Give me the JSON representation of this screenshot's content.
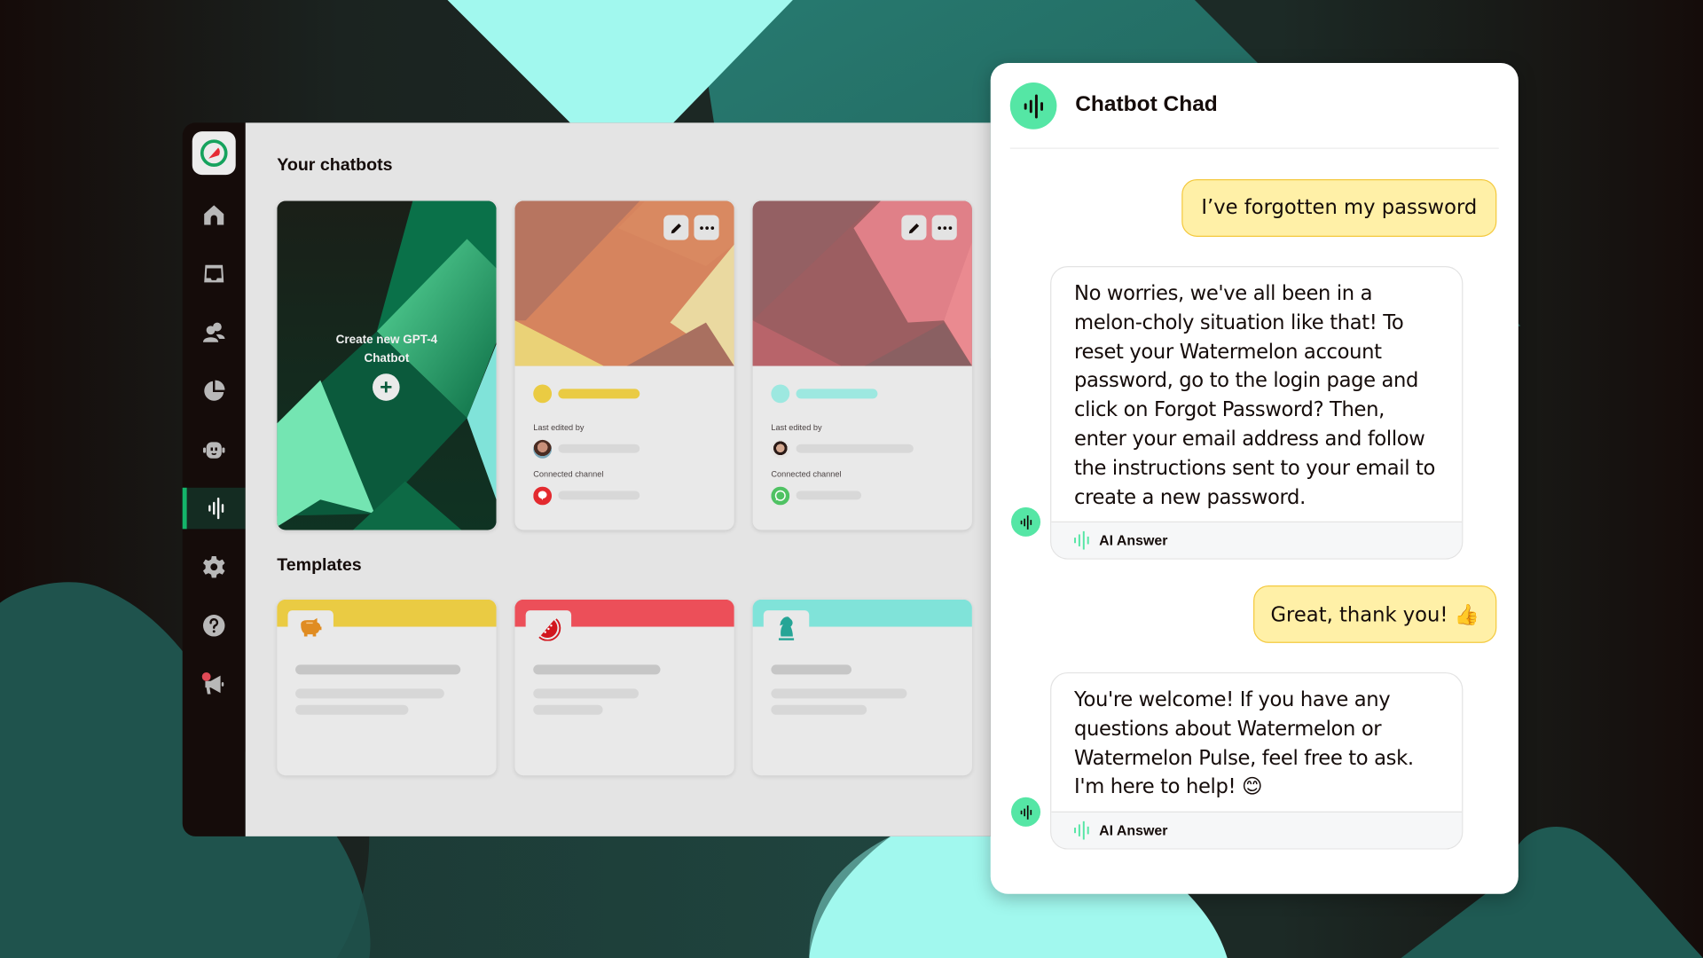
{
  "app": {
    "colors": {
      "accent_green": "#14b46a",
      "bot_avatar": "#55e6a5",
      "user_bubble": "#fff0a7",
      "user_bubble_border": "#f4c93e",
      "sidebar_bg": "#150c0a",
      "panel_bg": "#e4e4e4"
    }
  },
  "sidebar": {
    "logo": "watermelon-logo",
    "items": [
      {
        "name": "home",
        "icon": "home-icon",
        "active": false
      },
      {
        "name": "inbox",
        "icon": "inbox-icon",
        "active": false
      },
      {
        "name": "contacts",
        "icon": "users-icon",
        "active": false
      },
      {
        "name": "reports",
        "icon": "pie-chart-icon",
        "active": false
      },
      {
        "name": "bots",
        "icon": "robot-icon",
        "active": false
      },
      {
        "name": "chatbots",
        "icon": "soundwave-icon",
        "active": true
      },
      {
        "name": "settings",
        "icon": "gear-icon",
        "active": false
      },
      {
        "name": "help",
        "icon": "help-icon",
        "active": false
      },
      {
        "name": "announcements",
        "icon": "megaphone-icon",
        "active": false,
        "notification": true
      }
    ]
  },
  "main": {
    "chatbots_title": "Your chatbots",
    "create_card": {
      "label": "Create new GPT-4 Chatbot",
      "icon": "plus-icon"
    },
    "chatbots": [
      {
        "theme": "orange",
        "accent": "#eacb43",
        "last_edited_label": "Last edited by",
        "connected_channel_label": "Connected channel",
        "channel_icon": "livechat-icon",
        "channel_color": "#e32a2f",
        "edit_icon": "pencil-icon",
        "more_icon": "more-icon"
      },
      {
        "theme": "pink",
        "accent": "#9de8e0",
        "last_edited_label": "Last edited by",
        "connected_channel_label": "Connected channel",
        "channel_icon": "whatsapp-icon",
        "channel_color": "#4fc263",
        "edit_icon": "pencil-icon",
        "more_icon": "more-icon"
      }
    ],
    "templates_title": "Templates",
    "templates": [
      {
        "icon": "piggy-bank-icon",
        "color": "#eacb43",
        "icon_color": "#e08c22"
      },
      {
        "icon": "watermelon-icon",
        "color": "#ec4f59",
        "icon_color": "#d2161e"
      },
      {
        "icon": "chess-knight-icon",
        "color": "#80e3d9",
        "icon_color": "#26a596"
      }
    ]
  },
  "chat": {
    "bot_name": "Chatbot Chad",
    "messages": [
      {
        "from": "user",
        "text": "I’ve forgotten my password"
      },
      {
        "from": "bot",
        "text": "No worries, we've all been in a melon-choly situation like that! To reset your Watermelon account password, go to the login page and click on Forgot Password? Then, enter your email address and follow the instructions sent to your email to create a new password.",
        "footer": "AI Answer"
      },
      {
        "from": "user",
        "text": "Great, thank you! 👍"
      },
      {
        "from": "bot",
        "text": "You're welcome!  If you have any questions about Watermelon or Watermelon Pulse, feel free to ask. I'm here to help! 😊",
        "footer": "AI Answer"
      }
    ]
  }
}
